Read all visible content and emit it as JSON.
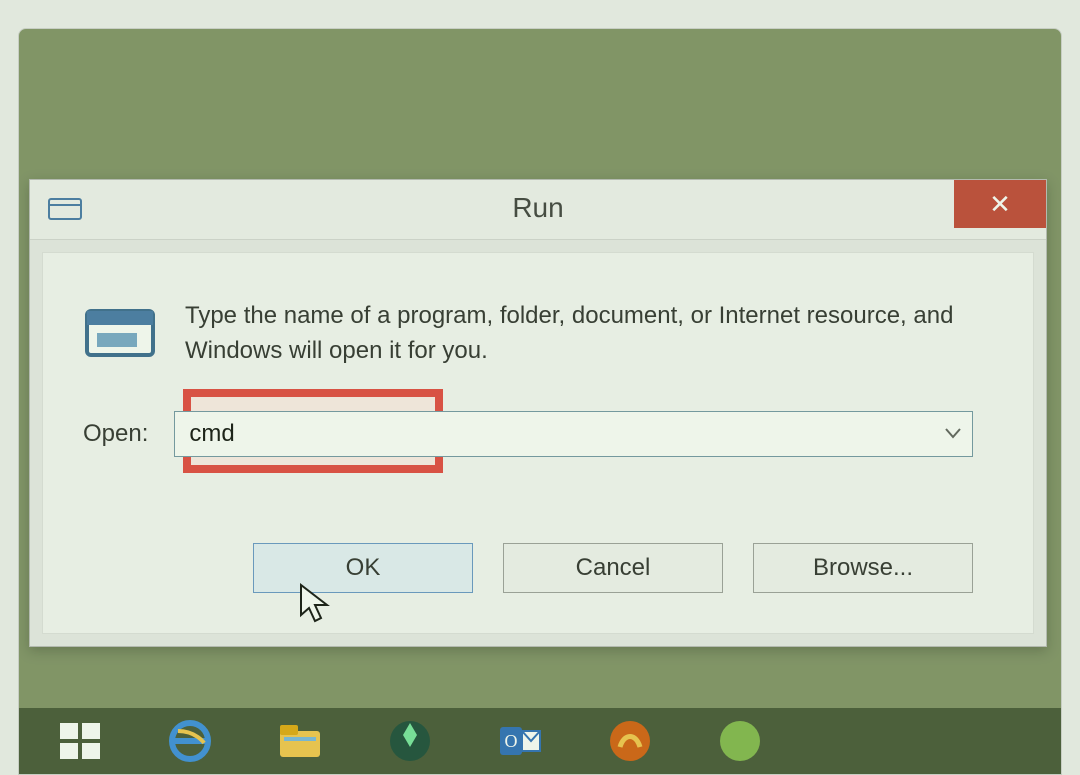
{
  "dialog": {
    "title": "Run",
    "description": "Type the name of a program, folder, document, or Internet resource, and Windows will open it for you.",
    "open_label": "Open:",
    "input_value": "cmd",
    "close_icon": "close-icon"
  },
  "buttons": {
    "ok": "OK",
    "cancel": "Cancel",
    "browse": "Browse..."
  },
  "taskbar": {
    "start": "start-icon",
    "ie": "internet-explorer-icon",
    "explorer": "file-explorer-icon",
    "sims": "app-icon",
    "outlook": "outlook-icon",
    "app1": "app-icon-2",
    "app2": "app-icon-3"
  },
  "colors": {
    "close_btn": "#c0392b",
    "highlight": "#e53935",
    "primary_border": "#5f8fc7"
  }
}
